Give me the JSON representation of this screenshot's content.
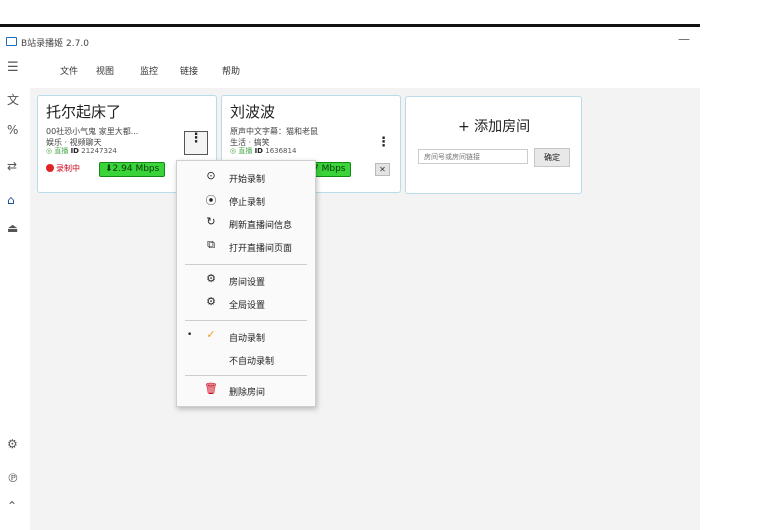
{
  "window": {
    "title": "B站录播姬 2.7.0",
    "minimize": "—"
  },
  "menubar": {
    "items": [
      "文件",
      "视图",
      "监控",
      "链接",
      "帮助"
    ]
  },
  "sidebar": {
    "icons": [
      "translate-icon",
      "percent-icon",
      "room-switch-icon",
      "home-icon",
      "inbox-icon",
      "gear-icon",
      "parking-icon",
      "more-icon"
    ]
  },
  "rooms": [
    {
      "name": "托尔起床了",
      "line1": "00社恐小气鬼 家里大都...",
      "line2": "娱乐 · 视频聊天",
      "live": "◎ 直播",
      "id_label": "ID",
      "id": "21247324",
      "status": "录制中",
      "speed": "⬇2.94 Mbps"
    },
    {
      "name": "刘波波",
      "line1": "原声中文字幕：猫和老鼠",
      "line2": "生活 · 搞笑",
      "live": "◎ 直播",
      "id_label": "ID",
      "id": "1636814",
      "speed": "7 Mbps",
      "close": "✕"
    }
  ],
  "add_room": {
    "title": "+ 添加房间",
    "placeholder": "房间号或房间链接",
    "confirm": "确定"
  },
  "context_menu": {
    "items": [
      {
        "icon": "⊙",
        "label": "开始录制"
      },
      {
        "icon": "⦿",
        "label": "停止录制"
      },
      {
        "icon": "↻",
        "label": "刷新直播间信息"
      },
      {
        "icon": "⧉",
        "label": "打开直播间页面"
      },
      {
        "icon": "⚙",
        "label": "房间设置"
      },
      {
        "icon": "⚙",
        "label": "全局设置"
      },
      {
        "icon": "✓",
        "label": "自动录制",
        "bullet": "•"
      },
      {
        "icon": "",
        "label": "不自动录制"
      },
      {
        "icon": "🗑",
        "label": "删除房间"
      }
    ]
  },
  "colors": {
    "accent": "#1b6fc2",
    "card_border": "#b9dce8",
    "speed_bg": "#3ad33a",
    "rec_red": "#e02424",
    "delete_red": "#d0021b"
  }
}
